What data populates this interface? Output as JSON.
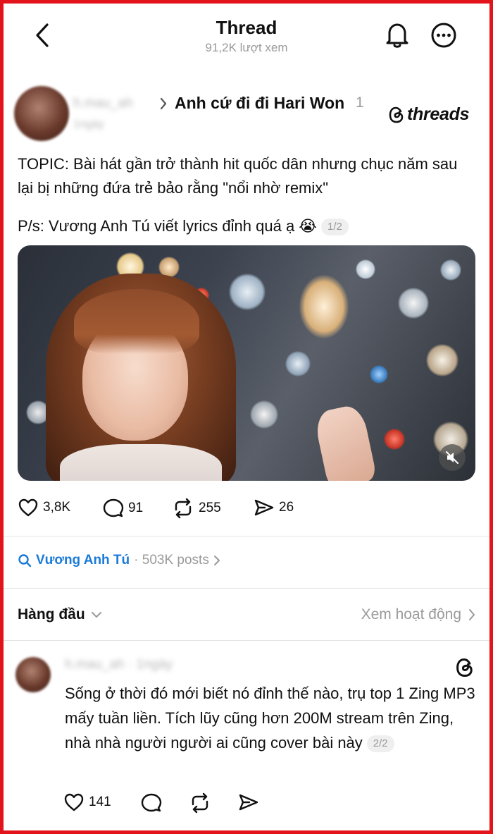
{
  "header": {
    "title": "Thread",
    "views": "91,2K lượt xem"
  },
  "post": {
    "topic": "Anh cứ đi đi Hari Won",
    "topic_count": "1",
    "brand": "threads",
    "text_line1": "TOPIC: Bài hát gần trở thành hit quốc dân nhưng chục năm sau lại bị những đứa trẻ bảo rằng \"nổi nhờ remix\"",
    "text_line2": "P/s: Vương Anh Tú viết lyrics đỉnh quá ạ 😭",
    "page_badge": "1/2",
    "likes": "3,8K",
    "comments": "91",
    "reposts": "255",
    "shares": "26"
  },
  "tag": {
    "name": "Vương Anh Tú",
    "count": "· 503K posts"
  },
  "sort": {
    "label": "Hàng đầu",
    "activity": "Xem hoạt động"
  },
  "reply": {
    "text": "Sống ở thời đó mới biết nó đỉnh thế nào, trụ top 1 Zing MP3 mấy tuần liền. Tích lũy cũng hơn 200M stream trên Zing, nhà nhà người người ai cũng cover bài này",
    "page_badge": "2/2",
    "likes": "141"
  },
  "colors": {
    "frame": "#e3131b",
    "link": "#1a7ad9",
    "muted": "#9a9a9a"
  },
  "icons": [
    "back-arrow-icon",
    "bell-icon",
    "more-icon",
    "threads-logo-icon",
    "heart-icon",
    "comment-icon",
    "repost-icon",
    "share-icon",
    "search-icon",
    "chevron-down-icon",
    "chevron-right-icon",
    "mute-icon"
  ]
}
